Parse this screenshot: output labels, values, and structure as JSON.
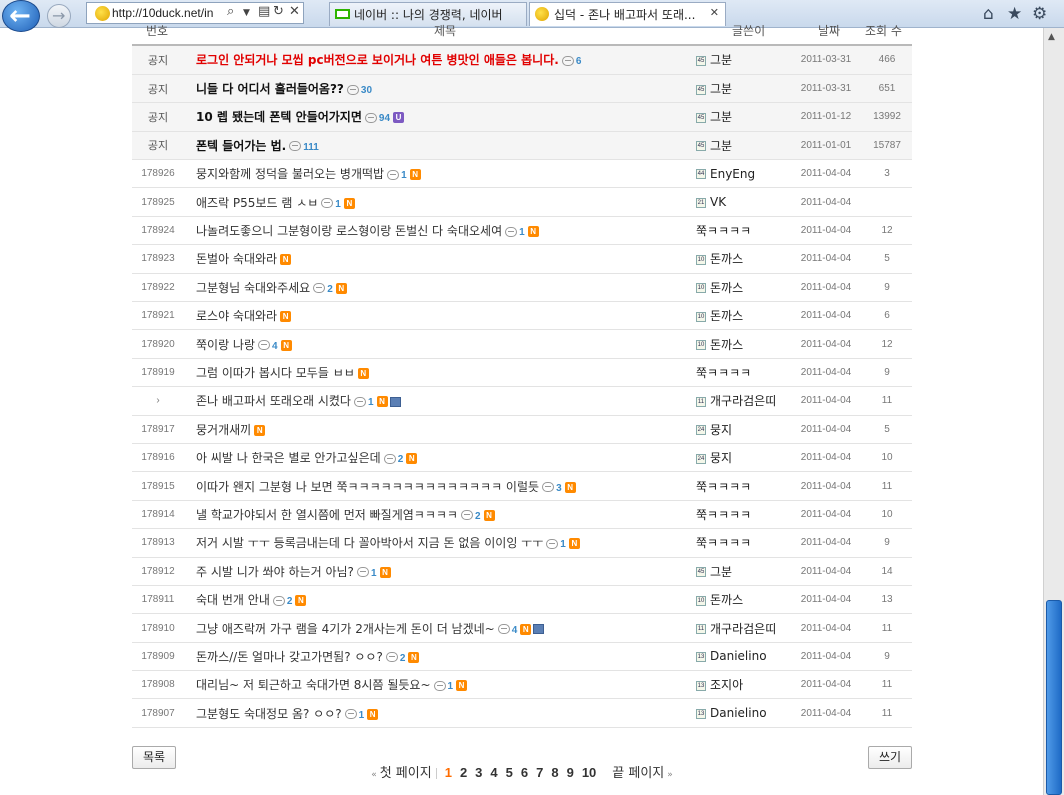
{
  "browser": {
    "url": "http://10duck.net/in",
    "tabs": [
      {
        "label": "네이버 :: 나의 경쟁력, 네이버"
      },
      {
        "label": "십덕 - 존나 배고파서 또래...",
        "close": "✕"
      }
    ]
  },
  "header": {
    "no": "번호",
    "title": "제목",
    "author": "글쓴이",
    "date": "날짜",
    "views": "조회 수"
  },
  "notices": [
    {
      "no": "공지",
      "title": "로그인 안되거나 모씹 pc버전으로 보이거나 여튼 병맛인 애들은 봅니다.",
      "comments": "6",
      "author": "그분",
      "level": "45",
      "date": "2011-03-31",
      "views": "466",
      "hot": true
    },
    {
      "no": "공지",
      "title": "니들 다 어디서 흘러들어옴??",
      "comments": "30",
      "author": "그분",
      "level": "45",
      "date": "2011-03-31",
      "views": "651"
    },
    {
      "no": "공지",
      "title": "10 렙 됐는데 폰텍 안들어가지면",
      "comments": "94",
      "badge": "U",
      "author": "그분",
      "level": "45",
      "date": "2011-01-12",
      "views": "13992"
    },
    {
      "no": "공지",
      "title": "폰텍 들어가는 법.",
      "comments": "111",
      "author": "그분",
      "level": "45",
      "date": "2011-01-01",
      "views": "15787"
    }
  ],
  "posts": [
    {
      "no": "178926",
      "title": "뭉지와함께 정덕을 불러오는 병개떡밥",
      "comments": "1",
      "new": "N",
      "author": "EnyEng",
      "level": "44",
      "date": "2011-04-04",
      "views": "3"
    },
    {
      "no": "178925",
      "title": "애즈락 P55보드 램 ㅅㅂ",
      "comments": "1",
      "new": "N",
      "author": "VK",
      "level": "21",
      "date": "2011-04-04",
      "views": ""
    },
    {
      "no": "178924",
      "title": "나놀려도좋으니 그분형이랑 로스형이랑 돈벌신 다 숙대오세여",
      "comments": "1",
      "new": "N",
      "author": "쭉ㅋㅋㅋㅋ",
      "level": "",
      "date": "2011-04-04",
      "views": "12"
    },
    {
      "no": "178923",
      "title": "돈벌아 숙대와라",
      "comments": "",
      "new": "N",
      "author": "돈까스",
      "level": "10",
      "date": "2011-04-04",
      "views": "5"
    },
    {
      "no": "178922",
      "title": "그분형님 숙대와주세요",
      "comments": "2",
      "new": "N",
      "author": "돈까스",
      "level": "10",
      "date": "2011-04-04",
      "views": "9"
    },
    {
      "no": "178921",
      "title": "로스야 숙대와라",
      "comments": "",
      "new": "N",
      "author": "돈까스",
      "level": "10",
      "date": "2011-04-04",
      "views": "6"
    },
    {
      "no": "178920",
      "title": "쭉이랑 나랑",
      "comments": "4",
      "new": "N",
      "author": "돈까스",
      "level": "10",
      "date": "2011-04-04",
      "views": "12"
    },
    {
      "no": "178919",
      "title": "그럼 이따가 봅시다 모두들 ㅂㅂ",
      "comments": "",
      "new": "N",
      "author": "쭉ㅋㅋㅋㅋ",
      "level": "",
      "date": "2011-04-04",
      "views": "9"
    },
    {
      "no": "›",
      "title": "존나 배고파서 또래오래 시켰다",
      "comments": "1",
      "new": "N",
      "file": true,
      "author": "개구라검은띠",
      "level": "11",
      "date": "2011-04-04",
      "views": "11"
    },
    {
      "no": "178917",
      "title": "뭉거개새끼",
      "comments": "",
      "new": "N",
      "author": "뭉지",
      "level": "24",
      "date": "2011-04-04",
      "views": "5"
    },
    {
      "no": "178916",
      "title": "아 씨발 나 한국은 별로 안가고싶은데",
      "comments": "2",
      "new": "N",
      "author": "뭉지",
      "level": "24",
      "date": "2011-04-04",
      "views": "10"
    },
    {
      "no": "178915",
      "title": "이따가 왠지 그분형 나 보면 쭉ㅋㅋㅋㅋㅋㅋㅋㅋㅋㅋㅋㅋㅋㅋ 이럴듯",
      "comments": "3",
      "new": "N",
      "author": "쭉ㅋㅋㅋㅋ",
      "level": "",
      "date": "2011-04-04",
      "views": "11"
    },
    {
      "no": "178914",
      "title": "낼 학교가야되서 한 열시쯤에 먼저 빠질게염ㅋㅋㅋㅋ",
      "comments": "2",
      "new": "N",
      "author": "쭉ㅋㅋㅋㅋ",
      "level": "",
      "date": "2011-04-04",
      "views": "10"
    },
    {
      "no": "178913",
      "title": "저거 시발 ㅜㅜ 등록금내는데 다 꼴아박아서 지금 돈 없음 이이잉 ㅜㅜ",
      "comments": "1",
      "new": "N",
      "author": "쭉ㅋㅋㅋㅋ",
      "level": "",
      "date": "2011-04-04",
      "views": "9"
    },
    {
      "no": "178912",
      "title": "주 시발 니가 쏴야 하는거 아님?",
      "comments": "1",
      "new": "N",
      "author": "그분",
      "level": "45",
      "date": "2011-04-04",
      "views": "14"
    },
    {
      "no": "178911",
      "title": "숙대 번개 안내",
      "comments": "2",
      "new": "N",
      "author": "돈까스",
      "level": "10",
      "date": "2011-04-04",
      "views": "13"
    },
    {
      "no": "178910",
      "title": "그냥 애즈락꺼 가구 램을 4기가 2개사는게 돈이 더 남겠네~",
      "comments": "4",
      "new": "N",
      "file": true,
      "author": "개구라검은띠",
      "level": "11",
      "date": "2011-04-04",
      "views": "11"
    },
    {
      "no": "178909",
      "title": "돈까스//돈 얼마나 갖고가면됨? ㅇㅇ?",
      "comments": "2",
      "new": "N",
      "author": "Danielino",
      "level": "13",
      "date": "2011-04-04",
      "views": "9"
    },
    {
      "no": "178908",
      "title": "대리님~ 저 퇴근하고 숙대가면 8시쯤 될듯요~",
      "comments": "1",
      "new": "N",
      "author": "조지아",
      "level": "13",
      "date": "2011-04-04",
      "views": "11"
    },
    {
      "no": "178907",
      "title": "그분형도 숙대정모 옴? ㅇㅇ?",
      "comments": "1",
      "new": "N",
      "author": "Danielino",
      "level": "13",
      "date": "2011-04-04",
      "views": "11"
    }
  ],
  "footer": {
    "list_button": "목록",
    "write_button": "쓰기",
    "first_page": "첫 페이지",
    "last_page": "끝 페이지",
    "pages": [
      "1",
      "2",
      "3",
      "4",
      "5",
      "6",
      "7",
      "8",
      "9",
      "10"
    ],
    "current_page": "1"
  }
}
